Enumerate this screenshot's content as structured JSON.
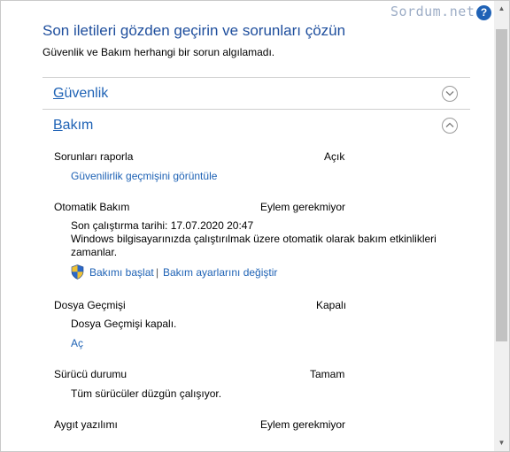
{
  "watermark": "Sordum.net",
  "help_icon_glyph": "?",
  "header": {
    "title": "Son iletileri gözden geçirin ve sorunları çözün",
    "subtitle": "Güvenlik ve Bakım herhangi bir sorun algılamadı."
  },
  "sections": {
    "security": {
      "initial": "G",
      "rest": "üvenlik",
      "state": "collapsed"
    },
    "maintenance": {
      "initial": "B",
      "rest": "akım",
      "state": "expanded"
    }
  },
  "maintenance": {
    "problem_reporting": {
      "label": "Sorunları raporla",
      "status": "Açık",
      "link": "Güvenilirlik geçmişini görüntüle"
    },
    "automatic_maintenance": {
      "label": "Otomatik Bakım",
      "status": "Eylem gerekmiyor",
      "last_run": "Son çalıştırma tarihi: 17.07.2020 20:47",
      "description": "Windows bilgisayarınızda çalıştırılmak üzere otomatik olarak bakım etkinlikleri zamanlar.",
      "start_link": "Bakımı başlat",
      "separator": "|",
      "settings_link": "Bakım ayarlarını değiştir"
    },
    "file_history": {
      "label": "Dosya Geçmişi",
      "status": "Kapalı",
      "detail": "Dosya Geçmişi kapalı.",
      "link": "Aç"
    },
    "drive_status": {
      "label": "Sürücü durumu",
      "status": "Tamam",
      "detail": "Tüm sürücüler düzgün çalışıyor."
    },
    "device_software": {
      "label": "Aygıt yazılımı",
      "status": "Eylem gerekmiyor"
    }
  },
  "colors": {
    "title_blue": "#1e4e9d",
    "link_blue": "#1e62b5",
    "watermark": "#9dadc6",
    "help_icon": "#1f62b6"
  },
  "icons": {
    "shield": "uac-shield-icon",
    "expand": "chevron-down-icon",
    "collapse": "chevron-up-icon",
    "help": "help-icon"
  }
}
